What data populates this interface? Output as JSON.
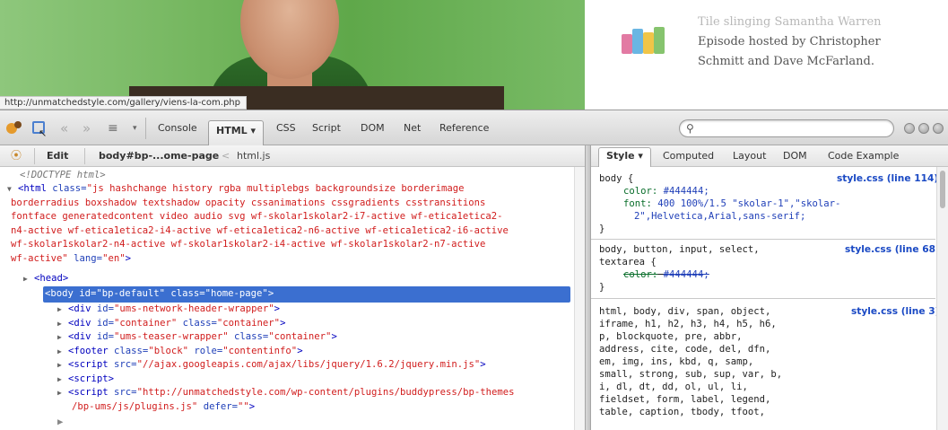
{
  "preview": {
    "status_url": "http://unmatchedstyle.com/gallery/viens-la-com.php",
    "promo_lines": [
      "",
      "Tile slinging Samantha Warren",
      "Episode hosted by Christopher",
      "Schmitt and Dave McFarland."
    ]
  },
  "toolbar": {
    "tabs": [
      "Console",
      "HTML ▾",
      "CSS",
      "Script",
      "DOM",
      "Net",
      "Reference"
    ],
    "search_value": ""
  },
  "html_panel": {
    "edit_label": "Edit",
    "breadcrumb": [
      "body#bp-...ome-page",
      "<",
      "html.js"
    ],
    "doctype": "<!DOCTYPE html>",
    "html_open": "<html",
    "html_class_attr": "class=",
    "html_class_value": "\"js hashchange history rgba multiplebgs backgroundsize borderimage",
    "html_class_lines": [
      "borderradius boxshadow textshadow opacity cssanimations cssgradients csstransitions",
      "fontface generatedcontent video audio svg wf-skolar1skolar2-i7-active wf-etica1etica2-",
      "n4-active wf-etica1etica2-i4-active wf-etica1etica2-n6-active wf-etica1etica2-i6-active",
      "wf-skolar1skolar2-n4-active wf-skolar1skolar2-i4-active wf-skolar1skolar2-n7-active",
      "wf-active\""
    ],
    "html_lang_attr": "lang=",
    "html_lang_value": "\"en\"",
    "html_close": ">",
    "head": "<head>",
    "body_open": "<body",
    "body_id_attr": "id=",
    "body_id_value": "\"bp-default\"",
    "body_class_attr": "class=",
    "body_class_value": "\"home-page\"",
    "body_close": ">",
    "children": [
      {
        "tag": "<div",
        "a1": "id=",
        "v1": "\"ums-network-header-wrapper\"",
        "end": ">"
      },
      {
        "tag": "<div",
        "a1": "id=",
        "v1": "\"container\"",
        "a2": "class=",
        "v2": "\"container\"",
        "end": ">"
      },
      {
        "tag": "<div",
        "a1": "id=",
        "v1": "\"ums-teaser-wrapper\"",
        "a2": "class=",
        "v2": "\"container\"",
        "end": ">"
      },
      {
        "tag": "<footer",
        "a1": "class=",
        "v1": "\"block\"",
        "a2": "role=",
        "v2": "\"contentinfo\"",
        "end": ">"
      },
      {
        "tag": "<script",
        "a1": "src=",
        "v1": "\"//ajax.googleapis.com/ajax/libs/jquery/1.6.2/jquery.min.js\"",
        "end": ">"
      },
      {
        "tag": "<script>"
      },
      {
        "tag": "<script",
        "a1": "src=",
        "v1": "\"http://unmatchedstyle.com/wp-content/plugins/buddypress/bp-themes",
        "cont": "/bp-ums/js/plugins.js\"",
        "a2": "defer=",
        "v2": "\"\"",
        "end": ">"
      }
    ]
  },
  "css_panel": {
    "tabs": [
      "Style ▾",
      "Computed",
      "Layout",
      "DOM",
      "Code Example"
    ],
    "rules": [
      {
        "selector": "body {",
        "source": "style.css (line 114)",
        "decls": [
          {
            "prop": "color:",
            "val": "#444444;"
          },
          {
            "prop": "font:",
            "val": "400 100%/1.5 \"skolar-1\",\"skolar-"
          },
          {
            "prop": "",
            "val": "2\",Helvetica,Arial,sans-serif;"
          }
        ],
        "close": "}"
      },
      {
        "selector": "body, button, input, select,",
        "selector2": "textarea {",
        "source": "style.css (line 68)",
        "decls": [
          {
            "prop": "color:",
            "val": "#444444;"
          }
        ],
        "close": "}"
      },
      {
        "selector": "html, body, div, span, object,",
        "source": "style.css (line 3)",
        "more": [
          "iframe, h1, h2, h3, h4, h5, h6,",
          "p, blockquote, pre, abbr,",
          "address, cite, code, del, dfn,",
          "em, img, ins, kbd, q, samp,",
          "small, strong, sub, sup, var, b,",
          "i, dl, dt, dd, ol, ul, li,",
          "fieldset, form, label, legend,",
          "table, caption, tbody, tfoot,"
        ]
      }
    ]
  },
  "colors": {
    "selection": "#3b6fd0",
    "tag": "#0000bf",
    "value": "#d11d1d",
    "source_link": "#1a49c4"
  }
}
